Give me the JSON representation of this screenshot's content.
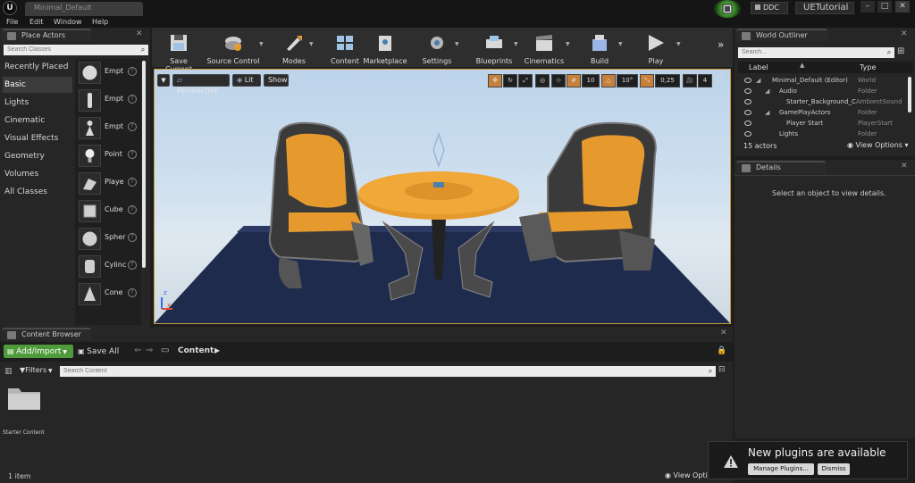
{
  "window": {
    "doc_tab": "Minimal_Default",
    "logo_text": "U",
    "ddc_label": "DDC",
    "project_name": "UETutorial",
    "menu": [
      "File",
      "Edit",
      "Window",
      "Help"
    ]
  },
  "place_actors": {
    "title": "Place Actors",
    "search_placeholder": "Search Classes",
    "categories": [
      "Recently Placed",
      "Basic",
      "Lights",
      "Cinematic",
      "Visual Effects",
      "Geometry",
      "Volumes",
      "All Classes"
    ],
    "selected_category": "Basic",
    "items": [
      {
        "label": "Empt",
        "icon": "sphere-icon"
      },
      {
        "label": "Empt",
        "icon": "character-icon"
      },
      {
        "label": "Empt",
        "icon": "pawn-icon"
      },
      {
        "label": "Point",
        "icon": "point-light-icon"
      },
      {
        "label": "Playe",
        "icon": "player-start-icon"
      },
      {
        "label": "Cube",
        "icon": "cube-icon"
      },
      {
        "label": "Spher",
        "icon": "sphere-mesh-icon"
      },
      {
        "label": "Cylinc",
        "icon": "cylinder-icon"
      },
      {
        "label": "Cone",
        "icon": "cone-icon"
      }
    ]
  },
  "toolbar": {
    "items": [
      {
        "label": "Save Current",
        "icon": "save-icon"
      },
      {
        "label": "Source Control",
        "icon": "source-control-icon"
      },
      {
        "label": "Modes",
        "icon": "modes-icon"
      },
      {
        "label": "Content",
        "icon": "content-icon"
      },
      {
        "label": "Marketplace",
        "icon": "marketplace-icon"
      },
      {
        "label": "Settings",
        "icon": "settings-icon"
      },
      {
        "label": "Blueprints",
        "icon": "blueprints-icon"
      },
      {
        "label": "Cinematics",
        "icon": "cinematics-icon"
      },
      {
        "label": "Build",
        "icon": "build-icon"
      },
      {
        "label": "Play",
        "icon": "play-icon"
      }
    ]
  },
  "viewport": {
    "perspective_label": "Perspective",
    "lit_label": "Lit",
    "show_label": "Show",
    "grid_snap": "10",
    "rotation_snap": "10°",
    "scale_snap": "0,25",
    "camera_speed": "4"
  },
  "world_outliner": {
    "title": "World Outliner",
    "search_placeholder": "Search...",
    "col_label": "Label",
    "col_type": "Type",
    "rows": [
      {
        "label": "Minimal_Default (Editor)",
        "type": "World",
        "indent": 0
      },
      {
        "label": "Audio",
        "type": "Folder",
        "indent": 1
      },
      {
        "label": "Starter_Background_Cue",
        "type": "AmbientSound",
        "indent": 2
      },
      {
        "label": "GamePlayActors",
        "type": "Folder",
        "indent": 1
      },
      {
        "label": "Player Start",
        "type": "PlayerStart",
        "indent": 2
      },
      {
        "label": "Lights",
        "type": "Folder",
        "indent": 1
      }
    ],
    "actor_count": "15 actors",
    "view_options": "View Options"
  },
  "details": {
    "title": "Details",
    "empty_text": "Select an object to view details."
  },
  "content_browser": {
    "title": "Content Browser",
    "add_import": "Add/Import",
    "save_all": "Save All",
    "path": "Content",
    "filters": "Filters",
    "search_placeholder": "Search Content",
    "folder_label": "Starter Content",
    "item_count": "1 item",
    "view_options": "View Opti"
  },
  "notification": {
    "text": "New plugins are available",
    "manage": "Manage Plugins...",
    "dismiss": "Dismiss"
  },
  "colors": {
    "accent_green": "#4f9a3a",
    "viewport_border": "#c79a3c",
    "seat_orange": "#e69a2e"
  }
}
